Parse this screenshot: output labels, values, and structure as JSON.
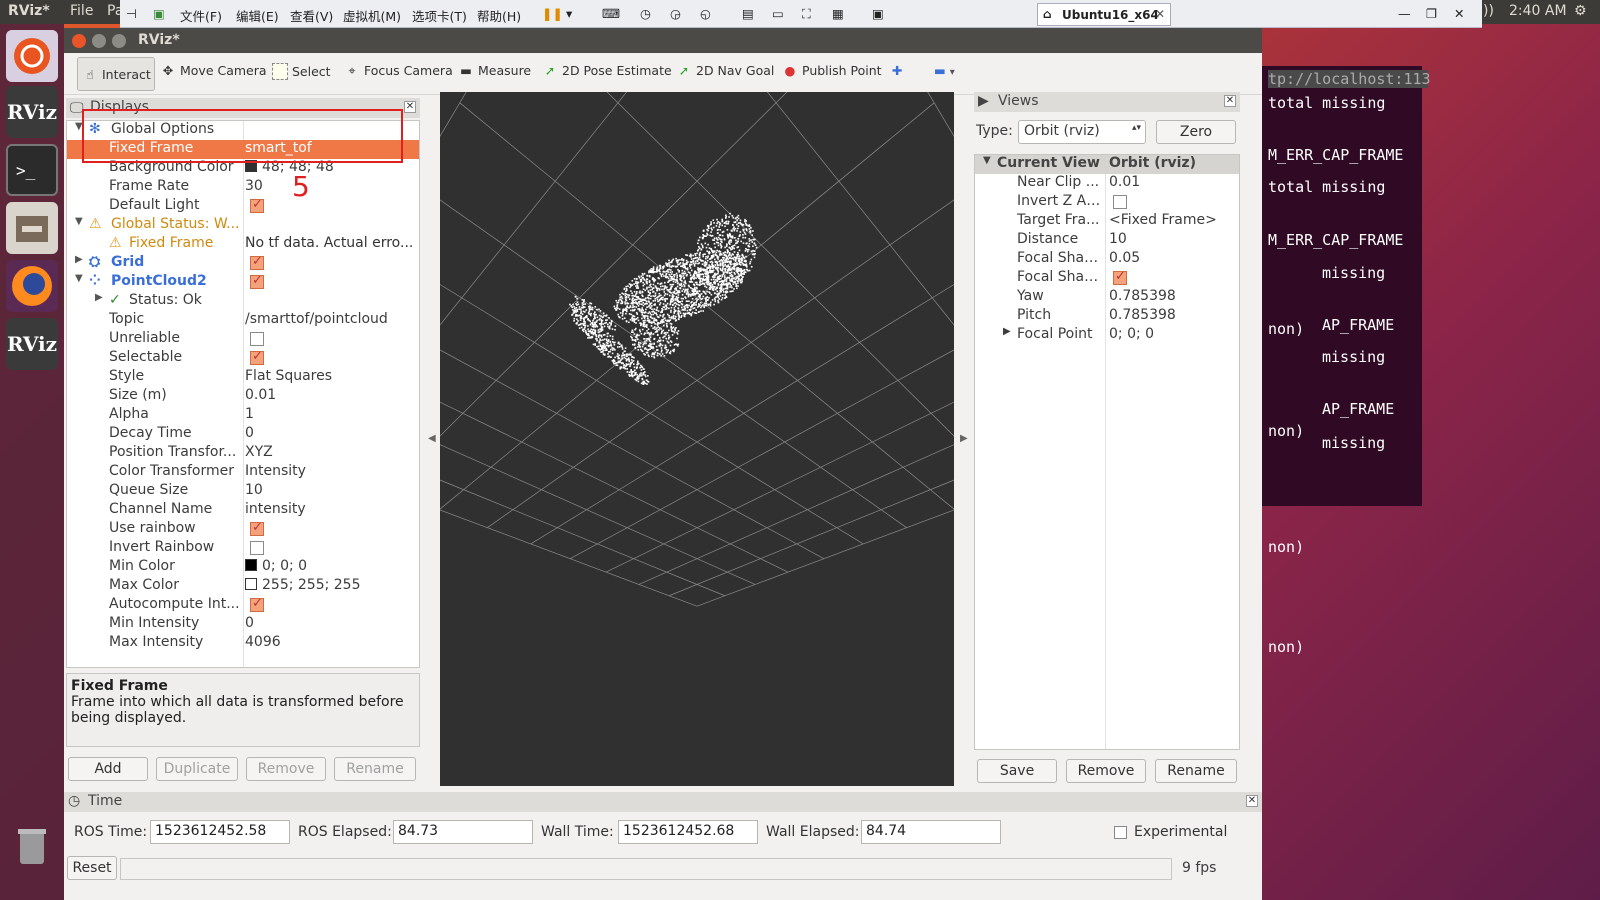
{
  "system": {
    "app_name": "RViz*",
    "menus": [
      "File",
      "Pa"
    ],
    "clock": "2:40 AM"
  },
  "vmware": {
    "menus": [
      "文件(F)",
      "编辑(E)",
      "查看(V)",
      "虚拟机(M)",
      "选项卡(T)",
      "帮助(H)"
    ],
    "tab_label": "Ubuntu16_x64"
  },
  "terminal": {
    "lines": [
      "tp://localhost:113",
      "total missing",
      "M_ERR_CAP_FRAME",
      "total missing",
      "M_ERR_CAP_FRAME",
      "missing",
      "non)",
      "AP_FRAME",
      "missing",
      "AP_FRAME",
      "non)",
      "missing",
      "non)",
      "non)"
    ]
  },
  "window": {
    "title": "RViz*"
  },
  "toolbar": {
    "interact": "Interact",
    "move_camera": "Move Camera",
    "select": "Select",
    "focus_camera": "Focus Camera",
    "measure": "Measure",
    "pose_estimate": "2D Pose Estimate",
    "nav_goal": "2D Nav Goal",
    "publish_point": "Publish Point"
  },
  "displays": {
    "title": "Displays",
    "rows": [
      {
        "name": "Global Options",
        "value": ""
      },
      {
        "name": "Fixed Frame",
        "value": "smart_tof"
      },
      {
        "name": "Background Color",
        "value": "48; 48; 48"
      },
      {
        "name": "Frame Rate",
        "value": "30"
      },
      {
        "name": "Default Light",
        "value": ""
      },
      {
        "name": "Global Status: W...",
        "value": ""
      },
      {
        "name": "Fixed Frame",
        "value": "No tf data.  Actual erro..."
      },
      {
        "name": "Grid",
        "value": ""
      },
      {
        "name": "PointCloud2",
        "value": ""
      },
      {
        "name": "Status: Ok",
        "value": ""
      },
      {
        "name": "Topic",
        "value": "/smarttof/pointcloud"
      },
      {
        "name": "Unreliable",
        "value": ""
      },
      {
        "name": "Selectable",
        "value": ""
      },
      {
        "name": "Style",
        "value": "Flat Squares"
      },
      {
        "name": "Size (m)",
        "value": "0.01"
      },
      {
        "name": "Alpha",
        "value": "1"
      },
      {
        "name": "Decay Time",
        "value": "0"
      },
      {
        "name": "Position Transfor...",
        "value": "XYZ"
      },
      {
        "name": "Color Transformer",
        "value": "Intensity"
      },
      {
        "name": "Queue Size",
        "value": "10"
      },
      {
        "name": "Channel Name",
        "value": "intensity"
      },
      {
        "name": "Use rainbow",
        "value": ""
      },
      {
        "name": "Invert Rainbow",
        "value": ""
      },
      {
        "name": "Min Color",
        "value": "0; 0; 0"
      },
      {
        "name": "Max Color",
        "value": "255; 255; 255"
      },
      {
        "name": "Autocompute Int...",
        "value": ""
      },
      {
        "name": "Min Intensity",
        "value": "0"
      },
      {
        "name": "Max Intensity",
        "value": "4096"
      }
    ],
    "annotation": "5",
    "desc_title": "Fixed Frame",
    "desc_text": "Frame into which all data is transformed before being displayed.",
    "buttons": [
      "Add",
      "Duplicate",
      "Remove",
      "Rename"
    ]
  },
  "views": {
    "title": "Views",
    "type_label": "Type:",
    "type_value": "Orbit (rviz)",
    "zero": "Zero",
    "rows": [
      {
        "name": "Current View",
        "value": "Orbit (rviz)"
      },
      {
        "name": "Near Clip ...",
        "value": "0.01"
      },
      {
        "name": "Invert Z Axis",
        "value": ""
      },
      {
        "name": "Target Fra...",
        "value": "<Fixed Frame>"
      },
      {
        "name": "Distance",
        "value": "10"
      },
      {
        "name": "Focal Shap...",
        "value": "0.05"
      },
      {
        "name": "Focal Shap...",
        "value": ""
      },
      {
        "name": "Yaw",
        "value": "0.785398"
      },
      {
        "name": "Pitch",
        "value": "0.785398"
      },
      {
        "name": "Focal Point",
        "value": "0; 0; 0"
      }
    ],
    "buttons": [
      "Save",
      "Remove",
      "Rename"
    ]
  },
  "time": {
    "title": "Time",
    "ros_time_label": "ROS Time:",
    "ros_time": "1523612452.58",
    "ros_elapsed_label": "ROS Elapsed:",
    "ros_elapsed": "84.73",
    "wall_time_label": "Wall Time:",
    "wall_time": "1523612452.68",
    "wall_elapsed_label": "Wall Elapsed:",
    "wall_elapsed": "84.74",
    "experimental": "Experimental"
  },
  "status": {
    "reset": "Reset",
    "fps": "9 fps"
  },
  "colors": {
    "accent": "#f07746",
    "viewport_bg": "#303030",
    "annotation": "#e02020"
  }
}
